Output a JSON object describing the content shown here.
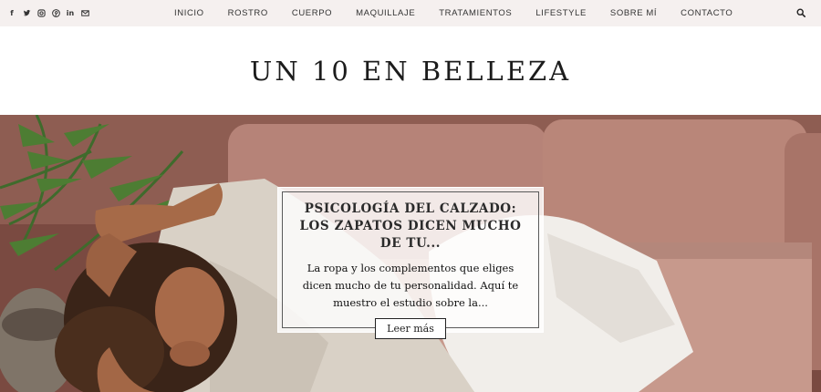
{
  "social": {
    "icons": [
      "facebook-icon",
      "twitter-icon",
      "instagram-icon",
      "pinterest-icon",
      "linkedin-icon",
      "email-icon"
    ]
  },
  "nav": {
    "items": [
      "INICIO",
      "ROSTRO",
      "CUERPO",
      "MAQUILLAJE",
      "TRATAMIENTOS",
      "LIFESTYLE",
      "SOBRE MÍ",
      "CONTACTO"
    ]
  },
  "site": {
    "title": "UN 10 EN BELLEZA"
  },
  "featured": {
    "title": "PSICOLOGÍA DEL CALZADO: LOS ZAPATOS DICEN MUCHO DE TU...",
    "excerpt": "La ropa y los complementos que eliges dicen mucho de tu personalidad. Aquí te muestro el estudio sobre la...",
    "button_label": "Leer más"
  },
  "colors": {
    "topbar": "#f5f0ef",
    "sofa": "#b48278",
    "wall": "#8a5a4f"
  }
}
